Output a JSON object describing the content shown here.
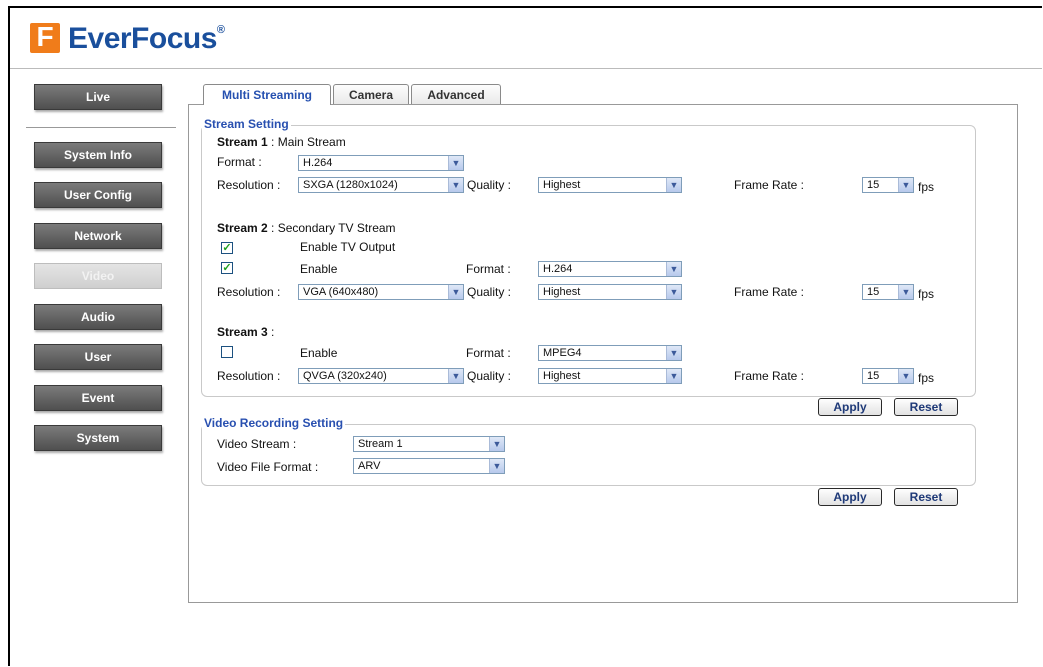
{
  "logo": {
    "brand": "EverFocus",
    "reg": "®"
  },
  "sidebar": [
    {
      "label": "Live"
    },
    {
      "label": "System Info"
    },
    {
      "label": "User Config"
    },
    {
      "label": "Network"
    },
    {
      "label": "Video",
      "active": true
    },
    {
      "label": "Audio"
    },
    {
      "label": "User"
    },
    {
      "label": "Event"
    },
    {
      "label": "System"
    }
  ],
  "tabs": [
    {
      "label": "Multi Streaming",
      "active": true
    },
    {
      "label": "Camera"
    },
    {
      "label": "Advanced"
    }
  ],
  "stream_setting": {
    "legend": "Stream Setting",
    "stream1": {
      "title": "Stream 1",
      "subtitle": " : Main Stream",
      "format_label": "Format :",
      "format_value": "H.264",
      "resolution_label": "Resolution :",
      "resolution_value": "SXGA (1280x1024)",
      "quality_label": "Quality :",
      "quality_value": "Highest",
      "framerate_label": "Frame Rate :",
      "framerate_value": "15",
      "fps": "fps"
    },
    "stream2": {
      "title": "Stream 2",
      "subtitle": " : Secondary TV Stream",
      "tv_output_label": "Enable TV Output",
      "tv_output_checked": true,
      "enable_label": "Enable",
      "enable_checked": true,
      "format_label": "Format :",
      "format_value": "H.264",
      "resolution_label": "Resolution :",
      "resolution_value": "VGA (640x480)",
      "quality_label": "Quality :",
      "quality_value": "Highest",
      "framerate_label": "Frame Rate :",
      "framerate_value": "15",
      "fps": "fps"
    },
    "stream3": {
      "title": "Stream 3",
      "subtitle": " :",
      "enable_label": "Enable",
      "enable_checked": false,
      "format_label": "Format :",
      "format_value": "MPEG4",
      "resolution_label": "Resolution :",
      "resolution_value": "QVGA (320x240)",
      "quality_label": "Quality :",
      "quality_value": "Highest",
      "framerate_label": "Frame Rate :",
      "framerate_value": "15",
      "fps": "fps"
    },
    "apply": "Apply",
    "reset": "Reset"
  },
  "recording": {
    "legend": "Video Recording Setting",
    "stream_label": "Video Stream :",
    "stream_value": "Stream 1",
    "file_format_label": "Video File Format :",
    "file_format_value": "ARV",
    "apply": "Apply",
    "reset": "Reset"
  },
  "colors": {
    "accent": "#2950b0",
    "logo_orange": "#f07c1a",
    "logo_blue": "#1a4f9c"
  }
}
